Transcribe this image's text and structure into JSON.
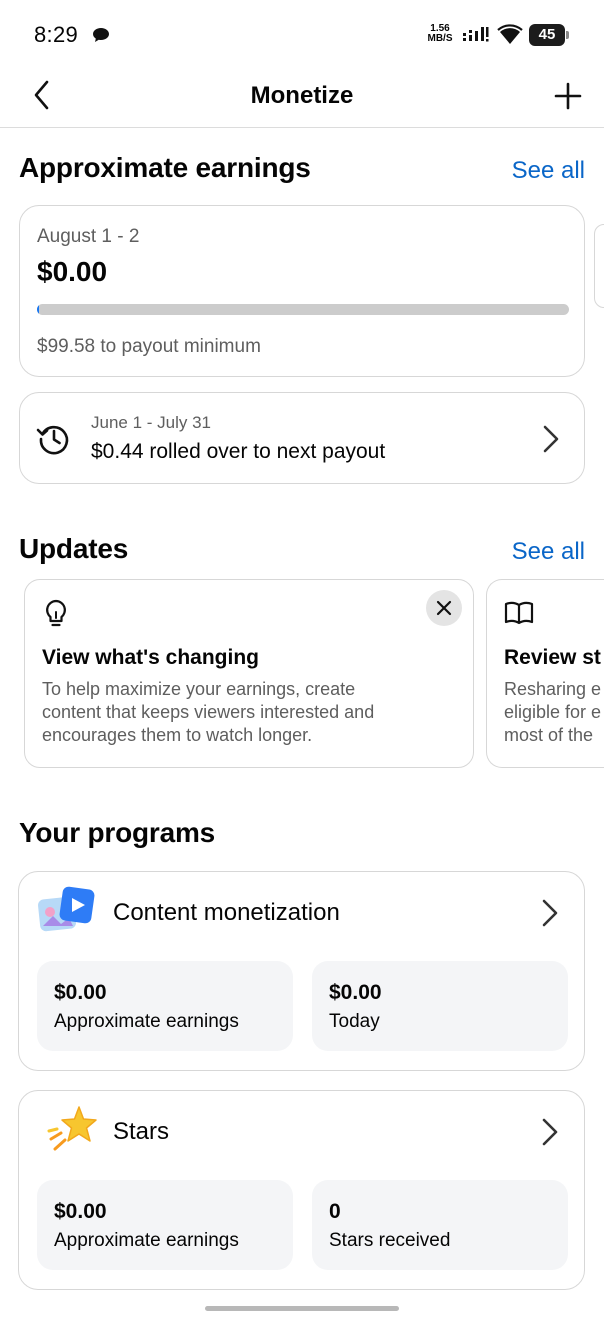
{
  "status_bar": {
    "time": "8:29",
    "net_speed_value": "1.56",
    "net_speed_unit": "MB/S",
    "battery": "45"
  },
  "header": {
    "title": "Monetize"
  },
  "earnings": {
    "section_title": "Approximate earnings",
    "see_all": "See all",
    "date_range": "August 1 - 2",
    "amount": "$0.00",
    "progress_fraction": 0.004,
    "payout_minimum_text": "$99.58 to payout minimum",
    "rollover_range": "June 1 - July 31",
    "rollover_text": "$0.44 rolled over to next payout"
  },
  "updates": {
    "section_title": "Updates",
    "see_all": "See all",
    "cards": [
      {
        "icon": "lightbulb-icon",
        "title": "View what's changing",
        "body": "To help maximize your earnings, create\ncontent that keeps viewers interested and\nencourages them to watch longer."
      },
      {
        "icon": "book-icon",
        "title": "Review st",
        "body": "Resharing e\neligible for e\nmost of the"
      }
    ]
  },
  "programs": {
    "section_title": "Your programs",
    "items": [
      {
        "icon": "content-monetization-icon",
        "title": "Content monetization",
        "stats": [
          {
            "value": "$0.00",
            "label": "Approximate earnings"
          },
          {
            "value": "$0.00",
            "label": "Today"
          }
        ]
      },
      {
        "icon": "star-icon",
        "title": "Stars",
        "stats": [
          {
            "value": "$0.00",
            "label": "Approximate earnings"
          },
          {
            "value": "0",
            "label": "Stars received"
          }
        ]
      }
    ]
  },
  "colors": {
    "accent": "#0a66c8",
    "progress": "#1877f2",
    "track": "#cccccc",
    "secondary_text": "#5e5e5e",
    "stat_bg": "#f4f5f7"
  }
}
